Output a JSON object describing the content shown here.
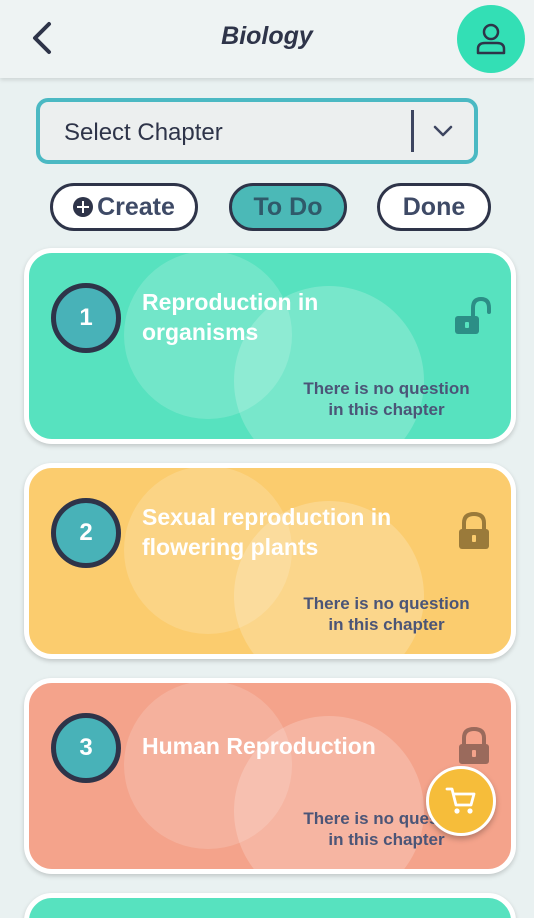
{
  "header": {
    "title": "Biology",
    "back_icon": "chevron-left-icon",
    "profile_icon": "user-icon"
  },
  "chapter_select": {
    "selected": "Select Chapter",
    "icon": "chevron-down-icon"
  },
  "filters": {
    "create_label": "Create",
    "todo_label": "To Do",
    "done_label": "Done",
    "active": "To Do"
  },
  "chapters": [
    {
      "number": "1",
      "name": "Reproduction in organisms",
      "note": "There is no question in this chapter",
      "lock_icon": "unlock-icon",
      "color": "#57e2bf"
    },
    {
      "number": "2",
      "name": "Sexual reproduction in flowering plants",
      "note": "There is no question in this chapter",
      "lock_icon": "lock-icon",
      "color": "#fbcc6e"
    },
    {
      "number": "3",
      "name": "Human Reproduction",
      "note": "There is no question in this chapter",
      "lock_icon": "lock-icon",
      "color": "#f4a38b"
    }
  ],
  "fab": {
    "icon": "cart-icon",
    "color": "#f6bd3a"
  },
  "colors": {
    "accent": "#33dfb5",
    "primary_dark": "#2e3449",
    "teal": "#4bb9c3"
  }
}
